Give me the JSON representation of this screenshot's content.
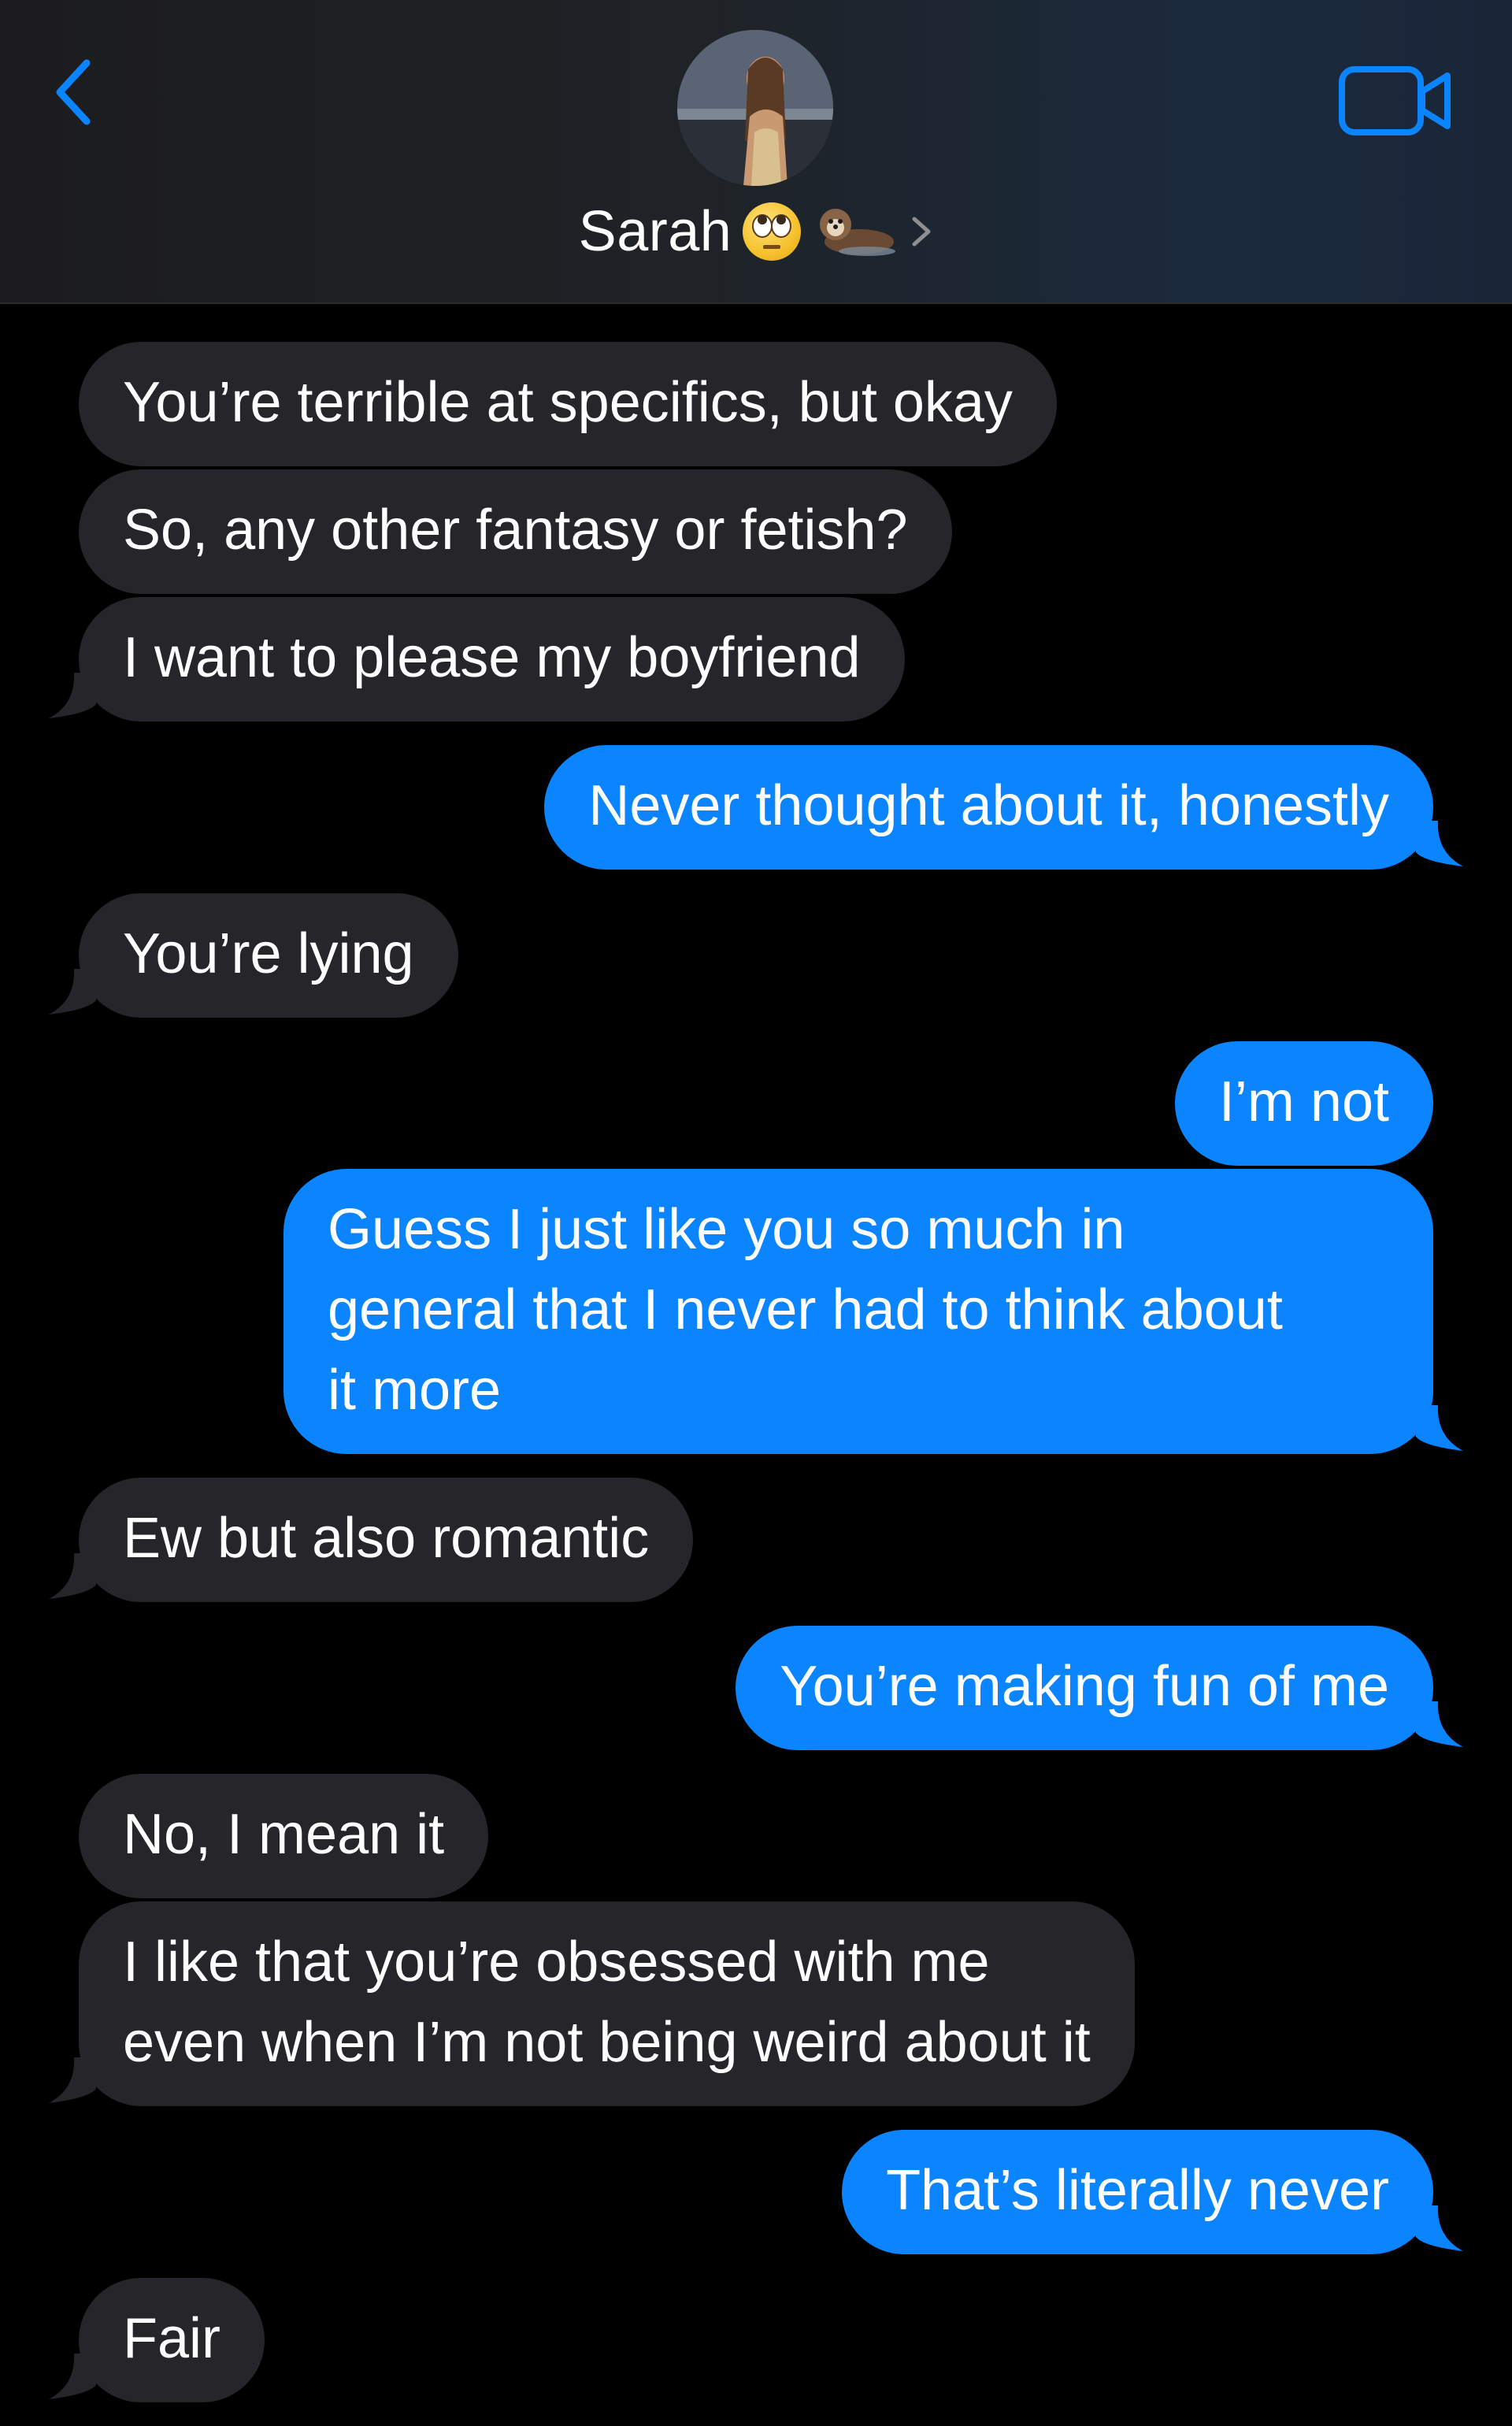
{
  "header": {
    "contact_name": "Sarah",
    "back_icon": "chevron-left-icon",
    "video_icon": "video-camera-icon",
    "emoji_1": "face-with-rolling-eyes-emoji",
    "emoji_2": "otter-emoji",
    "accent_color": "#0a84ff"
  },
  "colors": {
    "sent_bubble": "#0a84ff",
    "received_bubble": "#26252a",
    "background": "#000000"
  },
  "messages": [
    {
      "from": "them",
      "text": "You’re terrible at specifics, but okay"
    },
    {
      "from": "them",
      "text": "So, any other fantasy or fetish?"
    },
    {
      "from": "them",
      "text": "I want to please my boyfriend"
    },
    {
      "from": "me",
      "text": "Never thought about it, honestly"
    },
    {
      "from": "them",
      "text": "You’re lying"
    },
    {
      "from": "me",
      "text": "I’m not"
    },
    {
      "from": "me",
      "text": "Guess I just like you so much in\ngeneral that I never had to think about\nit more"
    },
    {
      "from": "them",
      "text": "Ew but also romantic"
    },
    {
      "from": "me",
      "text": "You’re making fun of me"
    },
    {
      "from": "them",
      "text": "No, I mean it"
    },
    {
      "from": "them",
      "text": "I like that you’re obsessed with me\neven when I’m not being weird about it"
    },
    {
      "from": "me",
      "text": "That’s literally never"
    },
    {
      "from": "them",
      "text": "Fair"
    }
  ]
}
